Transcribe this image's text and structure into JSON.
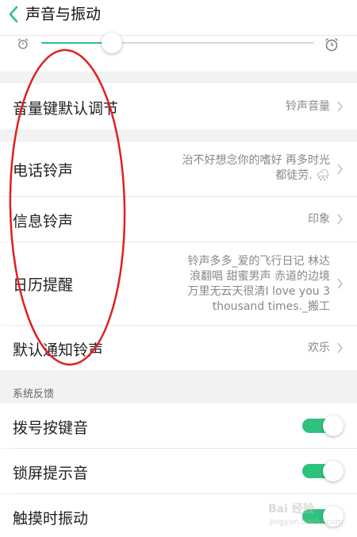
{
  "header": {
    "title": "声音与振动"
  },
  "slider": {
    "level": 0.26
  },
  "rows": [
    {
      "label": "音量键默认调节",
      "value_lines": [
        "铃声音量"
      ]
    },
    {
      "label": "电话铃声",
      "value_lines": [
        "治不好想念你的嗜好 再多时光",
        "都徒劳. 🌧"
      ]
    },
    {
      "label": "信息铃声",
      "value_lines": [
        "印象"
      ]
    },
    {
      "label": "日历提醒",
      "value_lines": [
        "铃声多多_爱的飞行日记 林达",
        "浪翻唱 甜蜜男声 赤道的边境",
        "万里无云天很清I love you 3",
        "thousand times._搬工"
      ]
    },
    {
      "label": "默认通知铃声",
      "value_lines": [
        "欢乐"
      ]
    }
  ],
  "section": {
    "title": "系统反馈"
  },
  "toggles": [
    {
      "label": "拨号按键音",
      "on": true
    },
    {
      "label": "锁屏提示音",
      "on": true
    },
    {
      "label": "触摸时振动",
      "on": true
    }
  ],
  "colors": {
    "accent": "#2ec27e",
    "annotation": "#e02020"
  },
  "watermark": {
    "brand": "Bai 经验",
    "site": "jingyan.baidu.com"
  }
}
